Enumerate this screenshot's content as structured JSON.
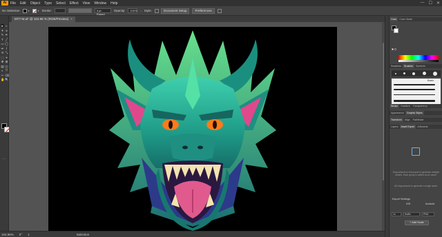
{
  "menu": {
    "logo": "Ai",
    "items": [
      "File",
      "Edit",
      "Object",
      "Type",
      "Select",
      "Effect",
      "View",
      "Window",
      "Help"
    ],
    "window_controls": [
      "—",
      "☐",
      "✕"
    ]
  },
  "control_bar": {
    "selection": "No Selection",
    "stroke_label": "Stroke:",
    "brush": "5 pt. Round",
    "opacity_label": "Opacity:",
    "opacity_value": "100%",
    "style_label": "Style:",
    "document_setup": "Document Setup",
    "preferences": "Preferences"
  },
  "document": {
    "tab_title": "MT7-M.ai* @ 104.96 % (RGB/Preview)",
    "close": "×"
  },
  "tools": [
    "▸",
    "▹",
    "✦",
    "⟡",
    "✎",
    "✒",
    "T",
    "╱",
    "▭",
    "◯",
    "✏",
    "⌇",
    "⟲",
    "⤡",
    "⬚",
    "⌖",
    "✥",
    "⊞",
    "▤",
    "◫",
    "◐",
    "⤧",
    "✂",
    "⌫",
    "✋",
    "🔍"
  ],
  "tools_more": "···",
  "status": {
    "zoom": "104.96%",
    "angle": "0°",
    "artboard": "1",
    "mode": "Selection"
  },
  "panels": {
    "color_tabs": [
      "Color",
      "Color Guide"
    ],
    "brush_tabs": [
      "Swatches",
      "Brushes",
      "Symbols"
    ],
    "brush_basic": "Basic",
    "stroke_tabs": [
      "Stroke",
      "Gradient",
      "Transparency"
    ],
    "appearance_tabs": [
      "Appearance",
      "Graphic Styles"
    ],
    "transform_tabs": [
      "Transform",
      "Align",
      "Pathfinder"
    ],
    "layers_tabs": [
      "Layers",
      "Asset Export",
      "Artboards"
    ],
    "asset_hint_1": "Drag artwork to this panel to generate multiple assets. Each group is added as an asset.",
    "asset_hint_2": "Alt drag artwork to generate a single asset.",
    "export_settings": "Export Settings",
    "ios": "iOS",
    "android": "Android",
    "scale": "1x",
    "suffix": "Suffix",
    "format": "PNG",
    "add_scale": "Add Scale"
  }
}
